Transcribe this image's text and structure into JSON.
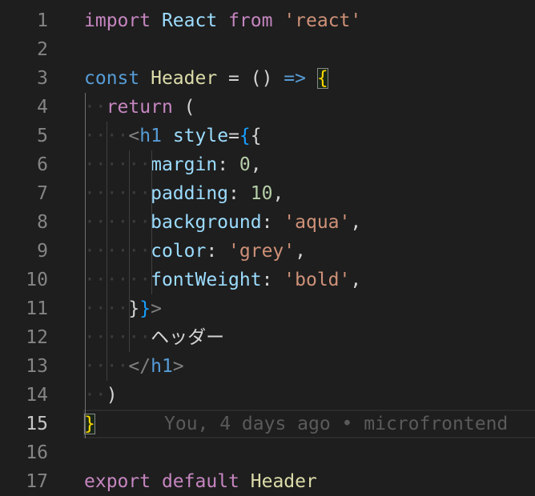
{
  "lines": [
    {
      "n": "1",
      "tokens": [
        [
          "kw-purple",
          "import"
        ],
        [
          "punc",
          " "
        ],
        [
          "prop",
          "React"
        ],
        [
          "punc",
          " "
        ],
        [
          "kw-purple",
          "from"
        ],
        [
          "punc",
          " "
        ],
        [
          "str",
          "'react'"
        ]
      ]
    },
    {
      "n": "2",
      "tokens": []
    },
    {
      "n": "3",
      "tokens": [
        [
          "kw-blue",
          "const"
        ],
        [
          "punc",
          " "
        ],
        [
          "fn-yellow",
          "Header"
        ],
        [
          "punc",
          " = () "
        ],
        [
          "kw-blue",
          "=>"
        ],
        [
          "punc",
          " "
        ],
        [
          "brace-yellow matched",
          "{"
        ]
      ]
    },
    {
      "n": "4",
      "tokens": [
        [
          "ws",
          "··"
        ],
        [
          "kw-purple",
          "return"
        ],
        [
          "punc",
          " ("
        ]
      ]
    },
    {
      "n": "5",
      "tokens": [
        [
          "ws",
          "····"
        ],
        [
          "tagbr",
          "<"
        ],
        [
          "tag",
          "h1"
        ],
        [
          "punc",
          " "
        ],
        [
          "prop",
          "style"
        ],
        [
          "punc",
          "="
        ],
        [
          "brace-blue",
          "{"
        ],
        [
          "punc",
          "{"
        ]
      ]
    },
    {
      "n": "6",
      "tokens": [
        [
          "ws",
          "······"
        ],
        [
          "prop",
          "margin"
        ],
        [
          "punc",
          ": "
        ],
        [
          "num",
          "0"
        ],
        [
          "punc",
          ","
        ]
      ]
    },
    {
      "n": "7",
      "tokens": [
        [
          "ws",
          "······"
        ],
        [
          "prop",
          "padding"
        ],
        [
          "punc",
          ": "
        ],
        [
          "num",
          "10"
        ],
        [
          "punc",
          ","
        ]
      ]
    },
    {
      "n": "8",
      "tokens": [
        [
          "ws",
          "······"
        ],
        [
          "prop",
          "background"
        ],
        [
          "punc",
          ": "
        ],
        [
          "str",
          "'aqua'"
        ],
        [
          "punc",
          ","
        ]
      ]
    },
    {
      "n": "9",
      "tokens": [
        [
          "ws",
          "······"
        ],
        [
          "prop",
          "color"
        ],
        [
          "punc",
          ": "
        ],
        [
          "str",
          "'grey'"
        ],
        [
          "punc",
          ","
        ]
      ]
    },
    {
      "n": "10",
      "tokens": [
        [
          "ws",
          "······"
        ],
        [
          "prop",
          "fontWeight"
        ],
        [
          "punc",
          ": "
        ],
        [
          "str",
          "'bold'"
        ],
        [
          "punc",
          ","
        ]
      ]
    },
    {
      "n": "11",
      "tokens": [
        [
          "ws",
          "····"
        ],
        [
          "punc",
          "}"
        ],
        [
          "brace-blue",
          "}"
        ],
        [
          "tagbr",
          ">"
        ]
      ]
    },
    {
      "n": "12",
      "tokens": [
        [
          "ws",
          "······"
        ],
        [
          "punc",
          "ヘッダー"
        ]
      ]
    },
    {
      "n": "13",
      "tokens": [
        [
          "ws",
          "····"
        ],
        [
          "tagbr",
          "</"
        ],
        [
          "tag",
          "h1"
        ],
        [
          "tagbr",
          ">"
        ]
      ]
    },
    {
      "n": "14",
      "tokens": [
        [
          "ws",
          "··"
        ],
        [
          "punc",
          ")"
        ]
      ]
    },
    {
      "n": "15",
      "tokens": [
        [
          "brace-yellow matched",
          "}"
        ]
      ],
      "blame": "You, 4 days ago • microfrontend"
    },
    {
      "n": "16",
      "tokens": []
    },
    {
      "n": "17",
      "tokens": [
        [
          "kw-purple",
          "export"
        ],
        [
          "punc",
          " "
        ],
        [
          "kw-purple",
          "default"
        ],
        [
          "punc",
          " "
        ],
        [
          "fn-yellow",
          "Header"
        ]
      ]
    }
  ],
  "active_line": "15"
}
